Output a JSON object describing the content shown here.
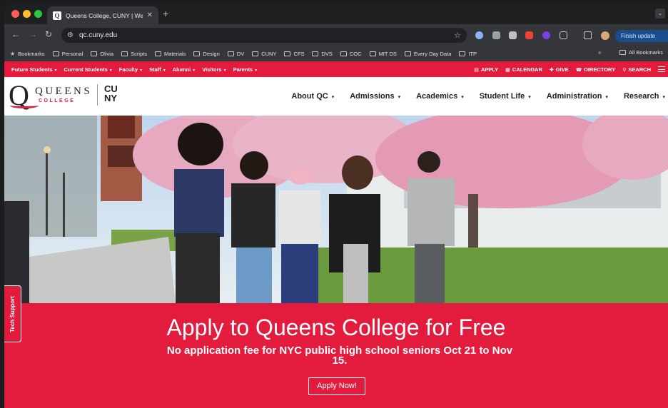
{
  "browser": {
    "tab_title": "Queens College, CUNY | We",
    "tab_favicon": "Q",
    "new_tab": "+",
    "url": "qc.cuny.edu",
    "finish_update": "Finish update",
    "bookmarks": [
      "Bookmarks",
      "Personal",
      "Olivia",
      "Scripts",
      "Materials",
      "Design",
      "DV",
      "CUNY",
      "CFS",
      "DVS",
      "COC",
      "MIT DS",
      "Every Day Data",
      "ITP"
    ],
    "more_bookmarks": "»",
    "all_bookmarks": "All Bookmarks"
  },
  "topnav": {
    "left": [
      {
        "label": "Future Students"
      },
      {
        "label": "Current Students"
      },
      {
        "label": "Faculty"
      },
      {
        "label": "Staff"
      },
      {
        "label": "Alumni"
      },
      {
        "label": "Visitors"
      },
      {
        "label": "Parents"
      }
    ],
    "right": [
      {
        "label": "APPLY",
        "icon": "document-icon"
      },
      {
        "label": "CALENDAR",
        "icon": "calendar-icon"
      },
      {
        "label": "GIVE",
        "icon": "gift-icon"
      },
      {
        "label": "DIRECTORY",
        "icon": "phone-icon"
      },
      {
        "label": "SEARCH",
        "icon": "search-icon"
      }
    ]
  },
  "logo": {
    "q": "Q",
    "queens": "QUEENS",
    "college": "COLLEGE",
    "cuny": "CU NY"
  },
  "mainnav": [
    "About QC",
    "Admissions",
    "Academics",
    "Student Life",
    "Administration",
    "Research"
  ],
  "tech_support": "Tech Support",
  "cta": {
    "title": "Apply to Queens College for Free",
    "subtitle": "No application fee for NYC public high school seniors Oct 21 to Nov 15.",
    "button": "Apply Now!"
  },
  "colors": {
    "brand_red": "#e31c3d",
    "chrome_dark": "#35363a"
  }
}
